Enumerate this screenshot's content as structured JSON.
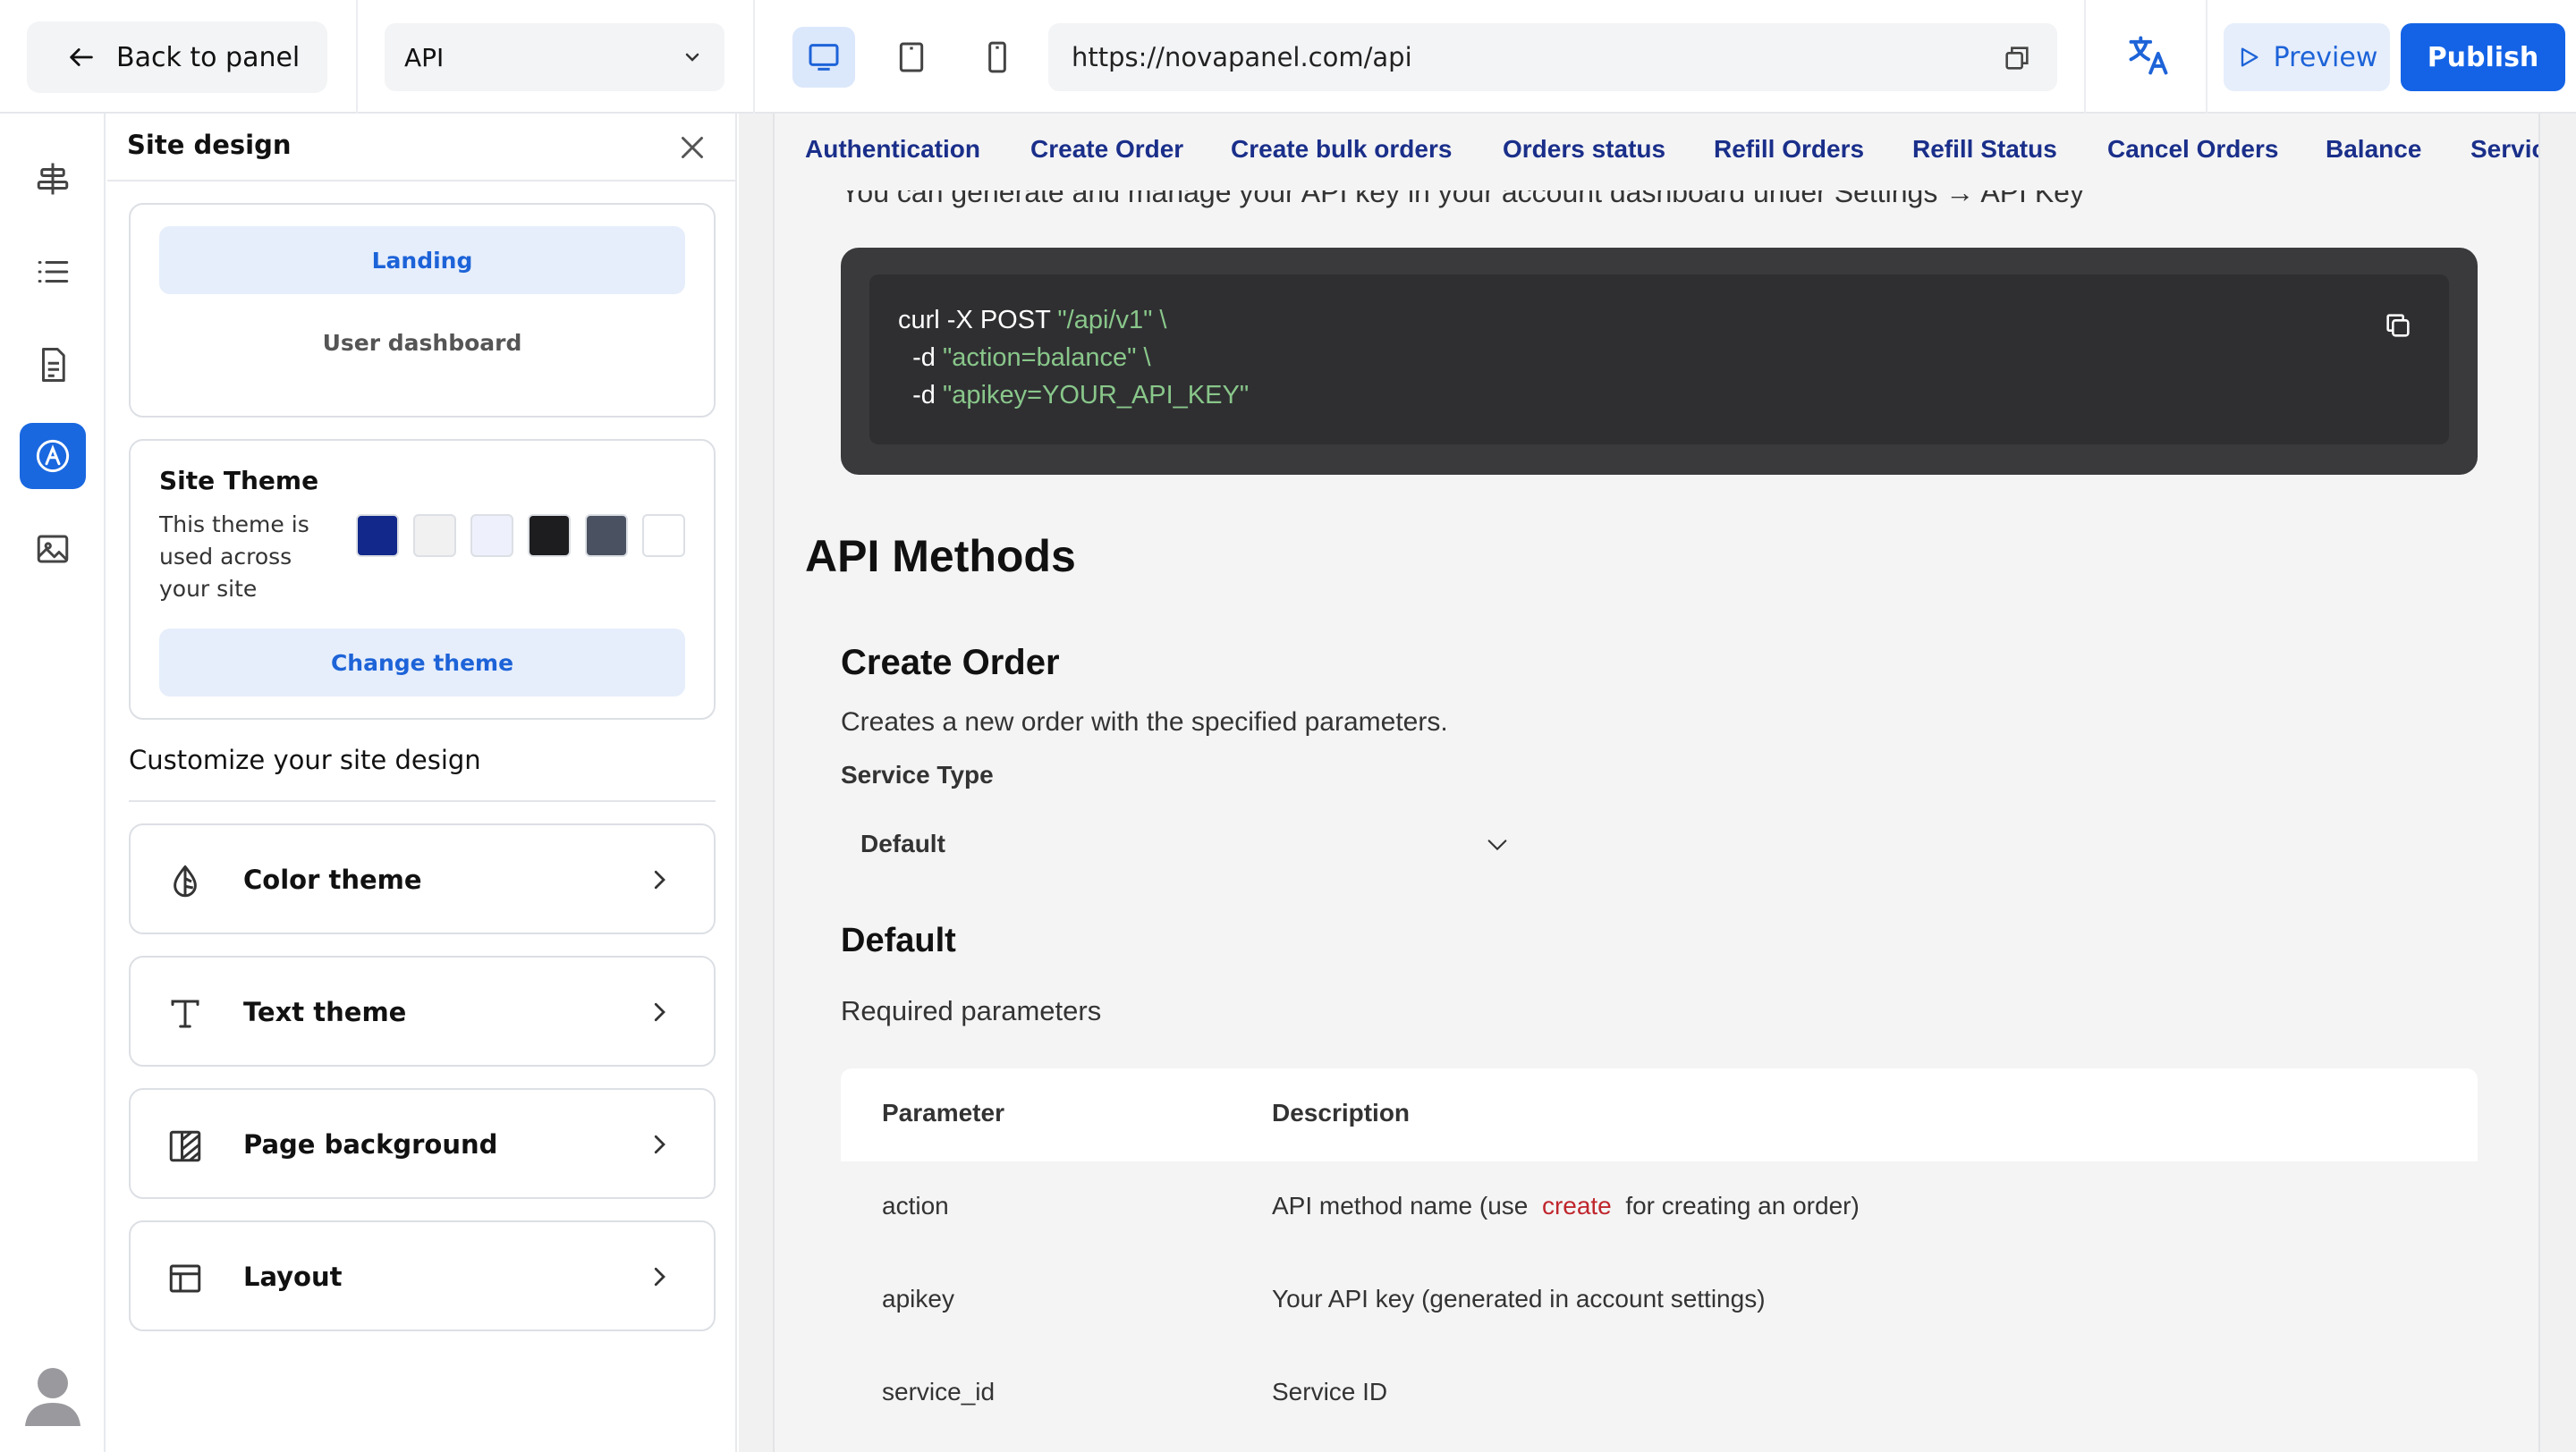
{
  "topbar": {
    "back_label": "Back to panel",
    "page_select_value": "API",
    "device_modes": [
      "desktop",
      "tablet",
      "mobile"
    ],
    "active_device": "desktop",
    "url": "https://novapanel.com/api",
    "preview_label": "Preview",
    "publish_label": "Publish"
  },
  "rail": {
    "items": [
      "align-icon",
      "list-icon",
      "document-icon",
      "design-icon",
      "image-icon"
    ],
    "active": "design-icon"
  },
  "panel": {
    "title": "Site design",
    "segments": {
      "active": "Landing",
      "idle": "User dashboard"
    },
    "theme": {
      "title": "Site Theme",
      "description": "This theme is used across your site",
      "swatches": [
        "#12288a",
        "#f1f1f2",
        "#eef0fb",
        "#1d1d1f",
        "#4a5261",
        "#ffffff"
      ],
      "change_label": "Change theme"
    },
    "customize_title": "Customize your site design",
    "options": [
      {
        "label": "Color theme",
        "icon": "drop-icon"
      },
      {
        "label": "Text theme",
        "icon": "text-icon"
      },
      {
        "label": "Page background",
        "icon": "background-icon"
      },
      {
        "label": "Layout",
        "icon": "layout-icon"
      }
    ]
  },
  "site": {
    "nav": [
      "Authentication",
      "Create Order",
      "Create bulk orders",
      "Orders status",
      "Refill Orders",
      "Refill Status",
      "Cancel Orders",
      "Balance",
      "Servic"
    ],
    "peek_text": "You can generate and manage your API key in your account dashboard under Settings → API Key",
    "code": {
      "line1_cmd": "curl -X POST ",
      "line1_str": "\"/api/v1\" \\",
      "line2_cmd": "  -d ",
      "line2_str": "\"action=balance\" \\",
      "line3_cmd": "  -d ",
      "line3_str": "\"apikey=YOUR_API_KEY\""
    },
    "methods_heading": "API Methods",
    "create_heading": "Create Order",
    "create_desc": "Creates a new order with the specified parameters.",
    "service_type_label": "Service Type",
    "service_type_value": "Default",
    "default_heading": "Default",
    "required_label": "Required parameters",
    "table": {
      "headers": [
        "Parameter",
        "Description"
      ],
      "rows": [
        {
          "param": "action",
          "desc_pre": "API method name (use ",
          "desc_code": "create",
          "desc_post": " for creating an order)"
        },
        {
          "param": "apikey",
          "desc": "Your API key (generated in account settings)"
        },
        {
          "param": "service_id",
          "desc": "Service ID"
        }
      ]
    }
  }
}
